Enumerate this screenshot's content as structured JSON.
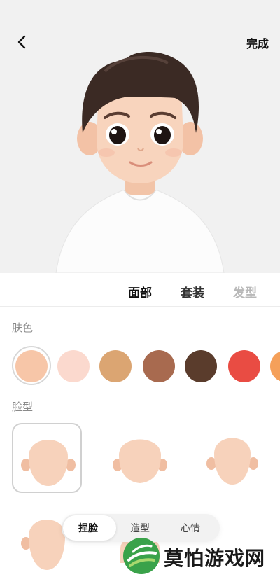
{
  "header": {
    "done_label": "完成"
  },
  "tabs": [
    {
      "label": "面部",
      "state": "active"
    },
    {
      "label": "套装",
      "state": "normal"
    },
    {
      "label": "发型",
      "state": "faded"
    }
  ],
  "skin_section": {
    "title": "肤色",
    "swatches": [
      "#f7c6a8",
      "#fbd9ce",
      "#dba572",
      "#a86a4f",
      "#5a3c2c",
      "#e94c43",
      "#f5a05a"
    ],
    "selected_index": 0
  },
  "face_section": {
    "title": "脸型",
    "shapes": [
      "round",
      "wide",
      "oval",
      "round"
    ],
    "selected_index": 0
  },
  "bottom_nav": {
    "items": [
      "捏脸",
      "造型",
      "心情"
    ],
    "active_index": 0
  },
  "watermark": {
    "text": "莫怕游戏网",
    "colors": {
      "green": "#3aa24a",
      "light": "#a8d86e"
    }
  },
  "colors": {
    "skin": "#f6cfb5",
    "hair": "#3b2a24",
    "shirt": "#fdfdfd"
  }
}
